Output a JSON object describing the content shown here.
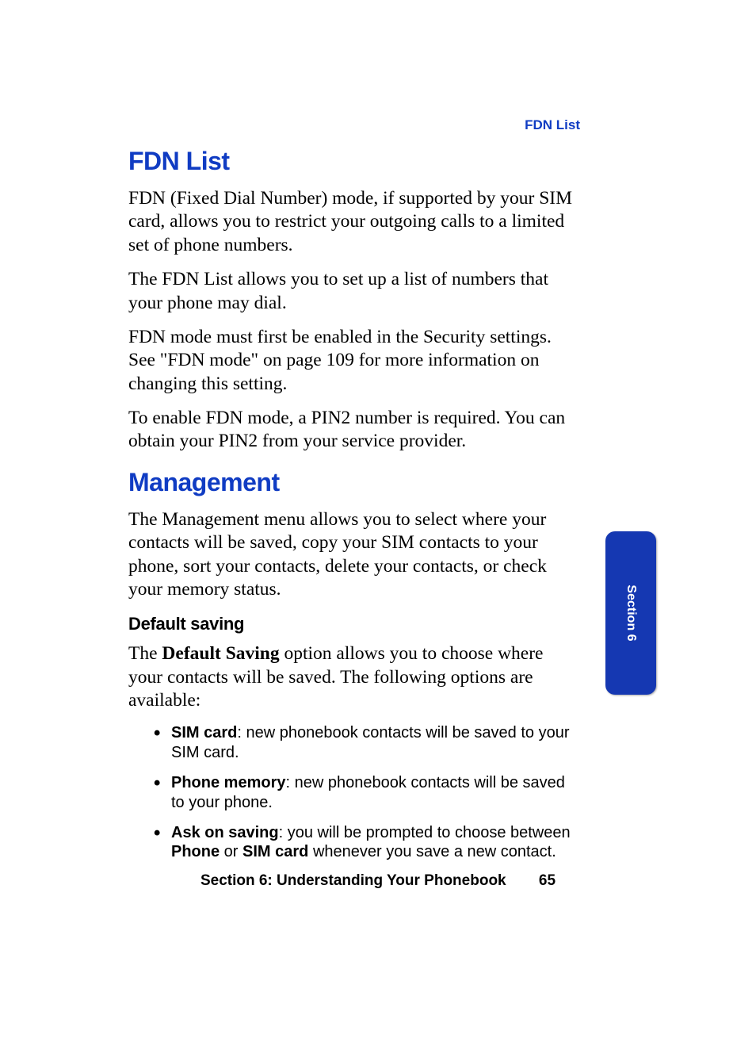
{
  "running_head": "FDN List",
  "sections": {
    "fdn": {
      "title": "FDN List",
      "p1": "FDN (Fixed Dial Number) mode, if supported by your SIM card, allows you to restrict your outgoing calls to a limited set of phone numbers.",
      "p2": "The FDN List allows you to set up a list of numbers that your phone may dial.",
      "p3": "FDN mode must first be enabled in the Security settings. See \"FDN mode\" on page 109 for more information on changing this setting.",
      "p4": "To enable FDN mode, a PIN2 number is required. You can obtain your PIN2 from your service provider."
    },
    "management": {
      "title": "Management",
      "p1": "The Management menu allows you to select where your contacts will be saved, copy your SIM contacts to your phone, sort your contacts, delete your contacts, or check your memory status.",
      "sub1": {
        "title": "Default saving",
        "intro_pre": "The ",
        "intro_bold": "Default Saving",
        "intro_post": " option allows you to choose where your contacts will be saved. The following options are available:",
        "items": [
          {
            "term": "SIM card",
            "desc": ": new phonebook contacts will be saved to your SIM card."
          },
          {
            "term": "Phone memory",
            "desc": ": new phonebook contacts will be saved to your phone."
          }
        ],
        "item3": {
          "term": "Ask on saving",
          "d1": ": you will be prompted to choose between ",
          "b1": "Phone",
          "d2": " or ",
          "b2": "SIM card",
          "d3": " whenever you save a new contact."
        }
      }
    }
  },
  "tab": {
    "label": "Section 6"
  },
  "footer": {
    "section": "Section 6: Understanding Your Phonebook",
    "page": "65"
  }
}
